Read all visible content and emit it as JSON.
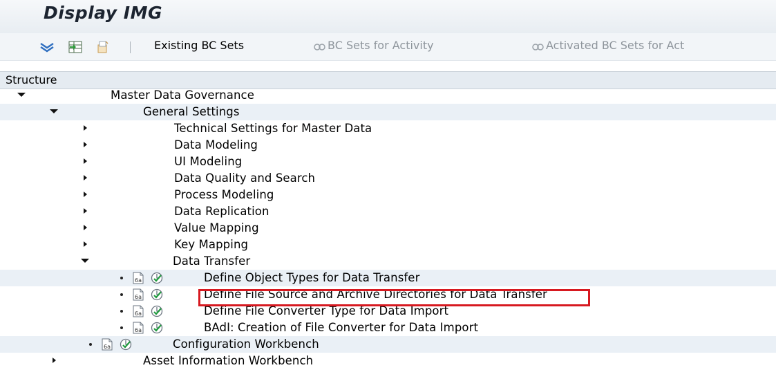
{
  "window": {
    "title": "Display IMG"
  },
  "toolbar": {
    "existing_bc_sets": "Existing BC Sets",
    "bc_sets_for_activity": "BC Sets for Activity",
    "activated_bc_sets": "Activated BC Sets for Act"
  },
  "structure": {
    "header": "Structure",
    "nodes": [
      {
        "label": "Master Data Governance"
      },
      {
        "label": "General Settings"
      },
      {
        "label": "Technical Settings for Master Data"
      },
      {
        "label": "Data Modeling"
      },
      {
        "label": "UI Modeling"
      },
      {
        "label": "Data Quality and Search"
      },
      {
        "label": "Process Modeling"
      },
      {
        "label": "Data Replication"
      },
      {
        "label": "Value Mapping"
      },
      {
        "label": "Key Mapping"
      },
      {
        "label": "Data Transfer"
      },
      {
        "label": "Define Object Types for Data Transfer"
      },
      {
        "label": "Define File Source and Archive Directories for Data Transfer"
      },
      {
        "label": "Define File Converter Type for Data Import"
      },
      {
        "label": "BAdI: Creation of File Converter for Data Import"
      },
      {
        "label": "Configuration Workbench"
      },
      {
        "label": "Asset Information Workbench"
      }
    ]
  },
  "colors": {
    "highlight_border": "#d71920",
    "header_bg": "#e5ebf1"
  }
}
